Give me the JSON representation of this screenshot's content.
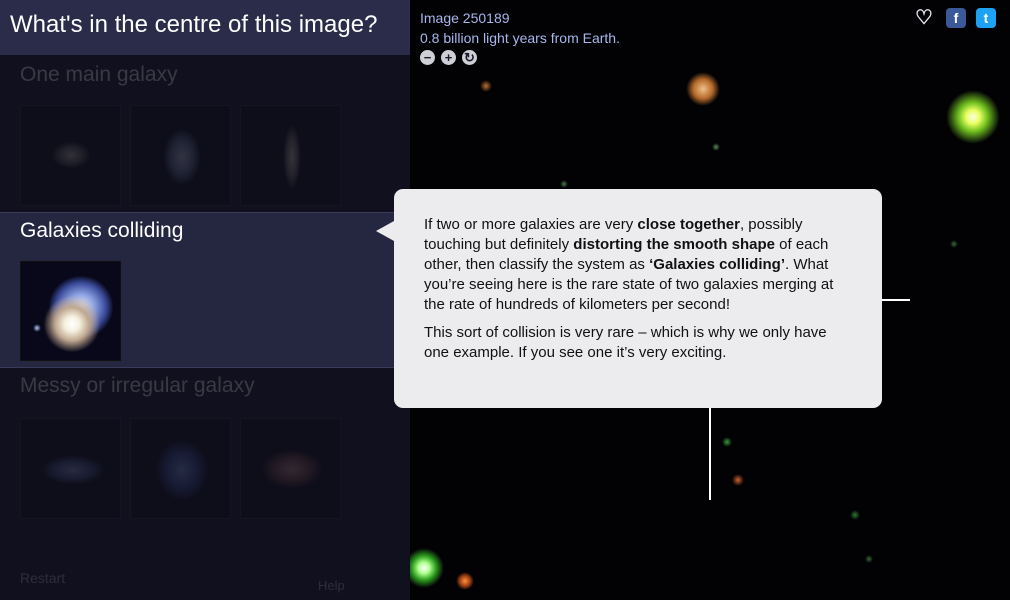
{
  "question": "What's in the centre of this image?",
  "sections": {
    "one_main": {
      "title": "One main galaxy"
    },
    "colliding": {
      "title": "Galaxies colliding"
    },
    "messy": {
      "title": "Messy or irregular galaxy"
    }
  },
  "bottom": {
    "left": "Restart",
    "right": "Help"
  },
  "image_info": {
    "id": "Image 250189",
    "distance": "0.8 billion light years from Earth."
  },
  "zoom": {
    "out": "−",
    "in": "+",
    "reset": "↻"
  },
  "share": {
    "favourite": "♡",
    "facebook": "f",
    "twitter": "t"
  },
  "tooltip": {
    "p1_a": "If two or more galaxies are very ",
    "p1_b": "close together",
    "p1_c": ", possibly touching but definitely ",
    "p1_d": "distorting the smooth shape",
    "p1_e": " of each other, then classify the system as ",
    "p1_f": "‘Galaxies colliding’",
    "p1_g": ". What you’re seeing here is the rare state of two galaxies merging at the rate of hundreds of kilometers per second!",
    "p2": "This sort of collision is very rare – which is why we only have one example.  If you see one it’s very exciting."
  },
  "colors": {
    "header_bg": "#2b2c49",
    "panel_bg": "#10101e",
    "selected_bg": "#25263f",
    "info_text": "#a9b6ea",
    "facebook": "#3b5998",
    "twitter": "#1da1f2"
  }
}
